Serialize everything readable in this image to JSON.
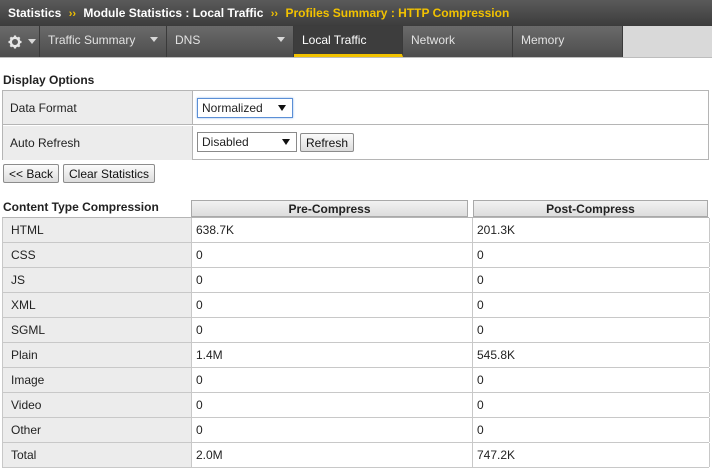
{
  "breadcrumb": {
    "items": [
      "Statistics",
      "Module Statistics : Local Traffic"
    ],
    "separator": "››",
    "current": "Profiles Summary : HTTP Compression"
  },
  "tabs": [
    {
      "label": "Traffic Summary",
      "has_menu": true
    },
    {
      "label": "DNS",
      "has_menu": true
    },
    {
      "label": "Local Traffic",
      "active": true
    },
    {
      "label": "Network"
    },
    {
      "label": "Memory"
    }
  ],
  "display_options": {
    "title": "Display Options",
    "data_format_label": "Data Format",
    "data_format_value": "Normalized",
    "auto_refresh_label": "Auto Refresh",
    "auto_refresh_value": "Disabled",
    "refresh_button": "Refresh"
  },
  "actions": {
    "back_button": "<< Back",
    "clear_button": "Clear Statistics"
  },
  "table": {
    "title": "Content Type Compression",
    "columns": [
      "Pre-Compress",
      "Post-Compress"
    ],
    "rows": [
      {
        "type": "HTML",
        "pre": "638.7K",
        "post": "201.3K"
      },
      {
        "type": "CSS",
        "pre": "0",
        "post": "0"
      },
      {
        "type": "JS",
        "pre": "0",
        "post": "0"
      },
      {
        "type": "XML",
        "pre": "0",
        "post": "0"
      },
      {
        "type": "SGML",
        "pre": "0",
        "post": "0"
      },
      {
        "type": "Plain",
        "pre": "1.4M",
        "post": "545.8K"
      },
      {
        "type": "Image",
        "pre": "0",
        "post": "0"
      },
      {
        "type": "Video",
        "pre": "0",
        "post": "0"
      },
      {
        "type": "Other",
        "pre": "0",
        "post": "0"
      },
      {
        "type": "Total",
        "pre": "2.0M",
        "post": "747.2K"
      }
    ]
  },
  "colors": {
    "accent": "#f2c200",
    "header_bg": "#4a4a4a",
    "label_bg": "#ececec"
  }
}
